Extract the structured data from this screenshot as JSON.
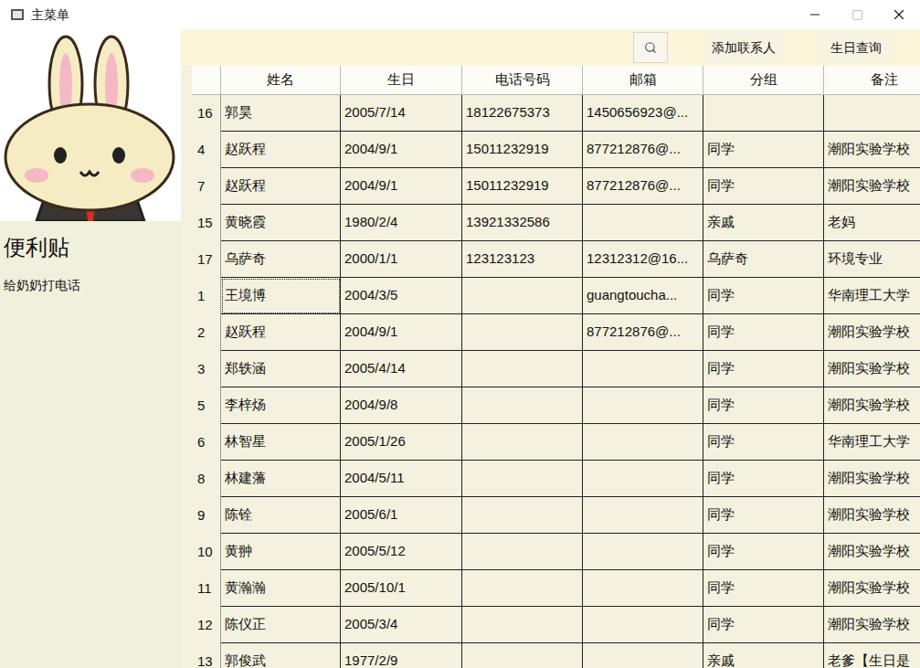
{
  "window": {
    "title": "主菜单"
  },
  "sidebar": {
    "sticky_note": {
      "title": "便利贴",
      "items": [
        "给奶奶打电话"
      ]
    }
  },
  "toolbar": {
    "search": {
      "value": ""
    },
    "buttons": [
      "添加联系人",
      "生日查询"
    ]
  },
  "table": {
    "columns": [
      "姓名",
      "生日",
      "电话号码",
      "邮箱",
      "分组",
      "备注"
    ],
    "rows": [
      {
        "index": "16",
        "focused": false,
        "cells": [
          "郭昊",
          "2005/7/14",
          "18122675373",
          "1450656923@...",
          "",
          ""
        ]
      },
      {
        "index": "4",
        "focused": false,
        "cells": [
          "赵跃程",
          "2004/9/1",
          "15011232919",
          "877212876@...",
          "同学",
          "潮阳实验学校"
        ]
      },
      {
        "index": "7",
        "focused": false,
        "cells": [
          "赵跃程",
          "2004/9/1",
          "15011232919",
          "877212876@...",
          "同学",
          "潮阳实验学校"
        ]
      },
      {
        "index": "15",
        "focused": false,
        "cells": [
          "黄晓霞",
          "1980/2/4",
          "13921332586",
          "",
          "亲戚",
          "老妈"
        ]
      },
      {
        "index": "17",
        "focused": false,
        "cells": [
          "乌萨奇",
          "2000/1/1",
          "123123123",
          "12312312@16...",
          "乌萨奇",
          "环境专业"
        ]
      },
      {
        "index": "1",
        "focused": true,
        "cells": [
          "王境博",
          "2004/3/5",
          "",
          "guangtoucha...",
          "同学",
          "华南理工大学"
        ]
      },
      {
        "index": "2",
        "focused": false,
        "cells": [
          "赵跃程",
          "2004/9/1",
          "",
          "877212876@...",
          "同学",
          "潮阳实验学校"
        ]
      },
      {
        "index": "3",
        "focused": false,
        "cells": [
          "郑轶涵",
          "2005/4/14",
          "",
          "",
          "同学",
          "潮阳实验学校"
        ]
      },
      {
        "index": "5",
        "focused": false,
        "cells": [
          "李梓炀",
          "2004/9/8",
          "",
          "",
          "同学",
          "潮阳实验学校"
        ]
      },
      {
        "index": "6",
        "focused": false,
        "cells": [
          "林智星",
          "2005/1/26",
          "",
          "",
          "同学",
          "华南理工大学"
        ]
      },
      {
        "index": "8",
        "focused": false,
        "cells": [
          "林建藩",
          "2004/5/11",
          "",
          "",
          "同学",
          "潮阳实验学校"
        ]
      },
      {
        "index": "9",
        "focused": false,
        "cells": [
          "陈铨",
          "2005/6/1",
          "",
          "",
          "同学",
          "潮阳实验学校"
        ]
      },
      {
        "index": "10",
        "focused": false,
        "cells": [
          "黄翀",
          "2005/5/12",
          "",
          "",
          "同学",
          "潮阳实验学校"
        ]
      },
      {
        "index": "11",
        "focused": false,
        "cells": [
          "黄瀚瀚",
          "2005/10/1",
          "",
          "",
          "同学",
          "潮阳实验学校"
        ]
      },
      {
        "index": "12",
        "focused": false,
        "cells": [
          "陈仪正",
          "2005/3/4",
          "",
          "",
          "同学",
          "潮阳实验学校"
        ]
      },
      {
        "index": "13",
        "focused": false,
        "cells": [
          "郭俊武",
          "1977/2/9",
          "",
          "",
          "亲戚",
          "老爹【生日是"
        ]
      }
    ]
  }
}
